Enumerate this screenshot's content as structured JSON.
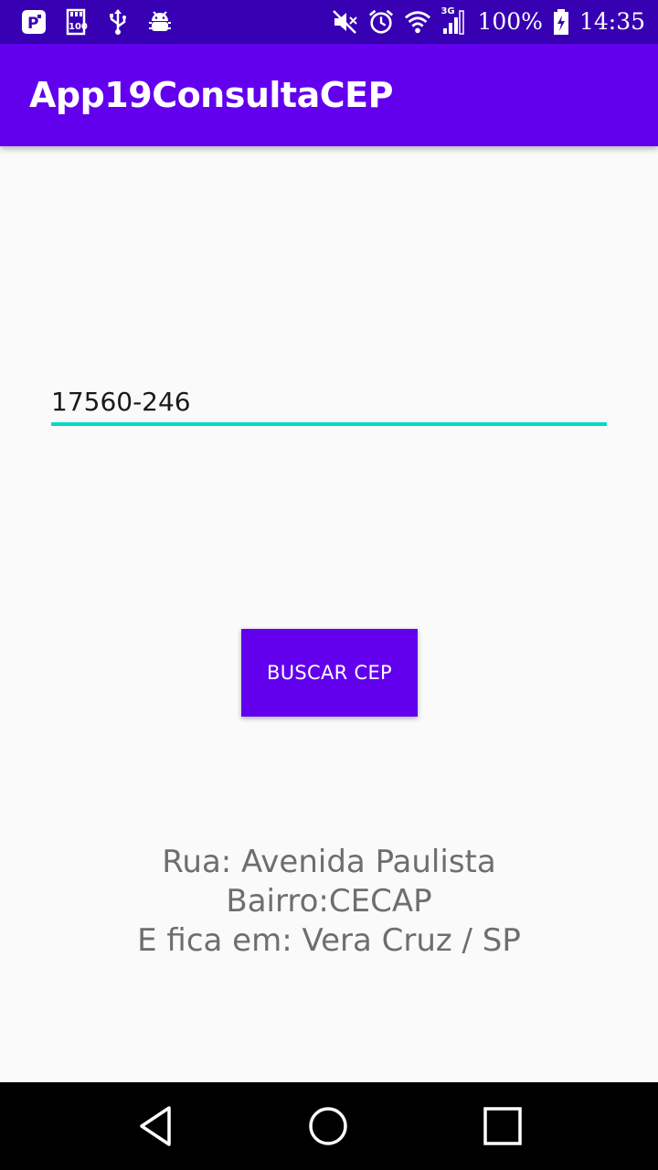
{
  "status_bar": {
    "left_icons": [
      "parking-icon",
      "sd-card-icon",
      "usb-icon",
      "android-debug-icon"
    ],
    "right_icons": [
      "mute-icon",
      "alarm-icon",
      "wifi-icon",
      "signal-3g-icon",
      "battery-charging-icon"
    ],
    "network_label": "3G",
    "battery": "100%",
    "time": "14:35"
  },
  "app_bar": {
    "title": "App19ConsultaCEP"
  },
  "form": {
    "cep_value": "17560-246"
  },
  "button": {
    "label": "BUSCAR CEP"
  },
  "result": {
    "line1": "Rua: Avenida Paulista",
    "line2": "Bairro:CECAP",
    "line3": "E fica em: Vera Cruz / SP"
  },
  "nav_bar": {
    "buttons": [
      "back-icon",
      "home-icon",
      "recents-icon"
    ]
  },
  "colors": {
    "primary": "#6200ee",
    "primary_dark": "#3700b3",
    "accent": "#03dac5",
    "background": "#fafafa",
    "result_text": "#6e6e6e"
  }
}
